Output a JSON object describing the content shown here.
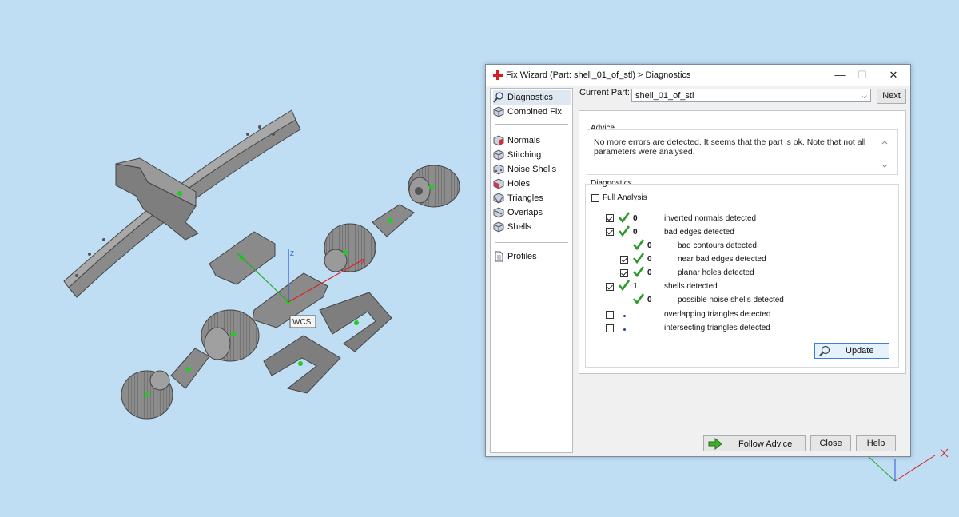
{
  "viewport": {
    "wcs_label": "WCS",
    "axis_z_label": "Z",
    "axis_x_label": "X",
    "colors": {
      "background": "#bfddf3",
      "part_fill": "#8f8f8f",
      "pivot": "#22cc22"
    }
  },
  "dialog": {
    "title": "Fix Wizard (Part: shell_01_of_stl) > Diagnostics",
    "window_controls": {
      "minimize": "—",
      "maximize": "☐",
      "close": "✕"
    },
    "nav": {
      "top": [
        {
          "label": "Diagnostics",
          "icon": "magnifier-icon",
          "selected": true
        },
        {
          "label": "Combined Fix",
          "icon": "cube-icon"
        }
      ],
      "tools": [
        {
          "label": "Normals",
          "icon": "normals-cube-icon"
        },
        {
          "label": "Stitching",
          "icon": "stitching-cube-icon"
        },
        {
          "label": "Noise Shells",
          "icon": "noise-cube-icon"
        },
        {
          "label": "Holes",
          "icon": "holes-cube-icon"
        },
        {
          "label": "Triangles",
          "icon": "triangles-cube-icon"
        },
        {
          "label": "Overlaps",
          "icon": "overlaps-cube-icon"
        },
        {
          "label": "Shells",
          "icon": "shells-cube-icon"
        }
      ],
      "profiles": {
        "label": "Profiles",
        "icon": "document-icon"
      }
    },
    "current_part": {
      "label": "Current Part:",
      "value": "shell_01_of_stl",
      "next_label": "Next"
    },
    "advice": {
      "heading": "Advice",
      "text": "No more errors are detected. It seems that the part is ok. Note that not all parameters were analysed."
    },
    "diagnostics": {
      "heading": "Diagnostics",
      "full_analysis_label": "Full Analysis",
      "rows": [
        {
          "checked": true,
          "status": "ok",
          "count": "0",
          "text": "inverted normals detected",
          "indent": false
        },
        {
          "checked": true,
          "status": "ok",
          "count": "0",
          "text": "bad edges detected",
          "indent": false
        },
        {
          "checked": null,
          "status": "ok",
          "count": "0",
          "text": "bad contours detected",
          "indent": true
        },
        {
          "checked": true,
          "status": "ok",
          "count": "0",
          "text": "near bad edges detected",
          "indent": true
        },
        {
          "checked": true,
          "status": "ok",
          "count": "0",
          "text": "planar holes detected",
          "indent": true
        },
        {
          "checked": true,
          "status": "ok",
          "count": "1",
          "text": "shells detected",
          "indent": false
        },
        {
          "checked": null,
          "status": "ok",
          "count": "0",
          "text": "possible noise shells detected",
          "indent": true
        },
        {
          "checked": false,
          "status": "none",
          "count": "",
          "text": "overlapping triangles detected",
          "indent": false
        },
        {
          "checked": false,
          "status": "none",
          "count": "",
          "text": "intersecting triangles detected",
          "indent": false
        }
      ],
      "update_label": "Update"
    },
    "footer": {
      "follow_advice": "Follow Advice",
      "close": "Close",
      "help": "Help"
    },
    "colors": {
      "check_green": "#2e9a2e",
      "accent": "#3a7ed6"
    }
  }
}
